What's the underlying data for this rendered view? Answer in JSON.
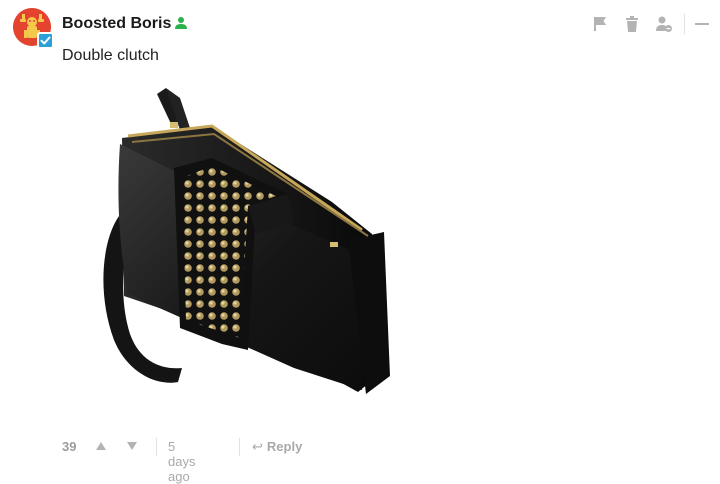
{
  "comment": {
    "author": "Boosted Boris",
    "body": "Double clutch",
    "votes": "39",
    "timestamp": "5 days ago",
    "reply_label": "Reply",
    "reply_glyph": "↩"
  },
  "icons": {
    "avatar": "mascot-avatar-icon",
    "verified_badge": "checkmark-badge-icon",
    "user_status": "user-icon",
    "flag": "flag-icon",
    "delete": "trash-icon",
    "block_user": "user-block-icon",
    "collapse": "minus-icon",
    "upvote": "caret-up-icon",
    "downvote": "caret-down-icon"
  },
  "colors": {
    "avatar_bg": "#e3432f",
    "verified_badge": "#2a9fd8",
    "user_status_icon": "#2bb24c",
    "muted_icons": "#b3b3b3",
    "footer_text": "#a9a9a9"
  }
}
